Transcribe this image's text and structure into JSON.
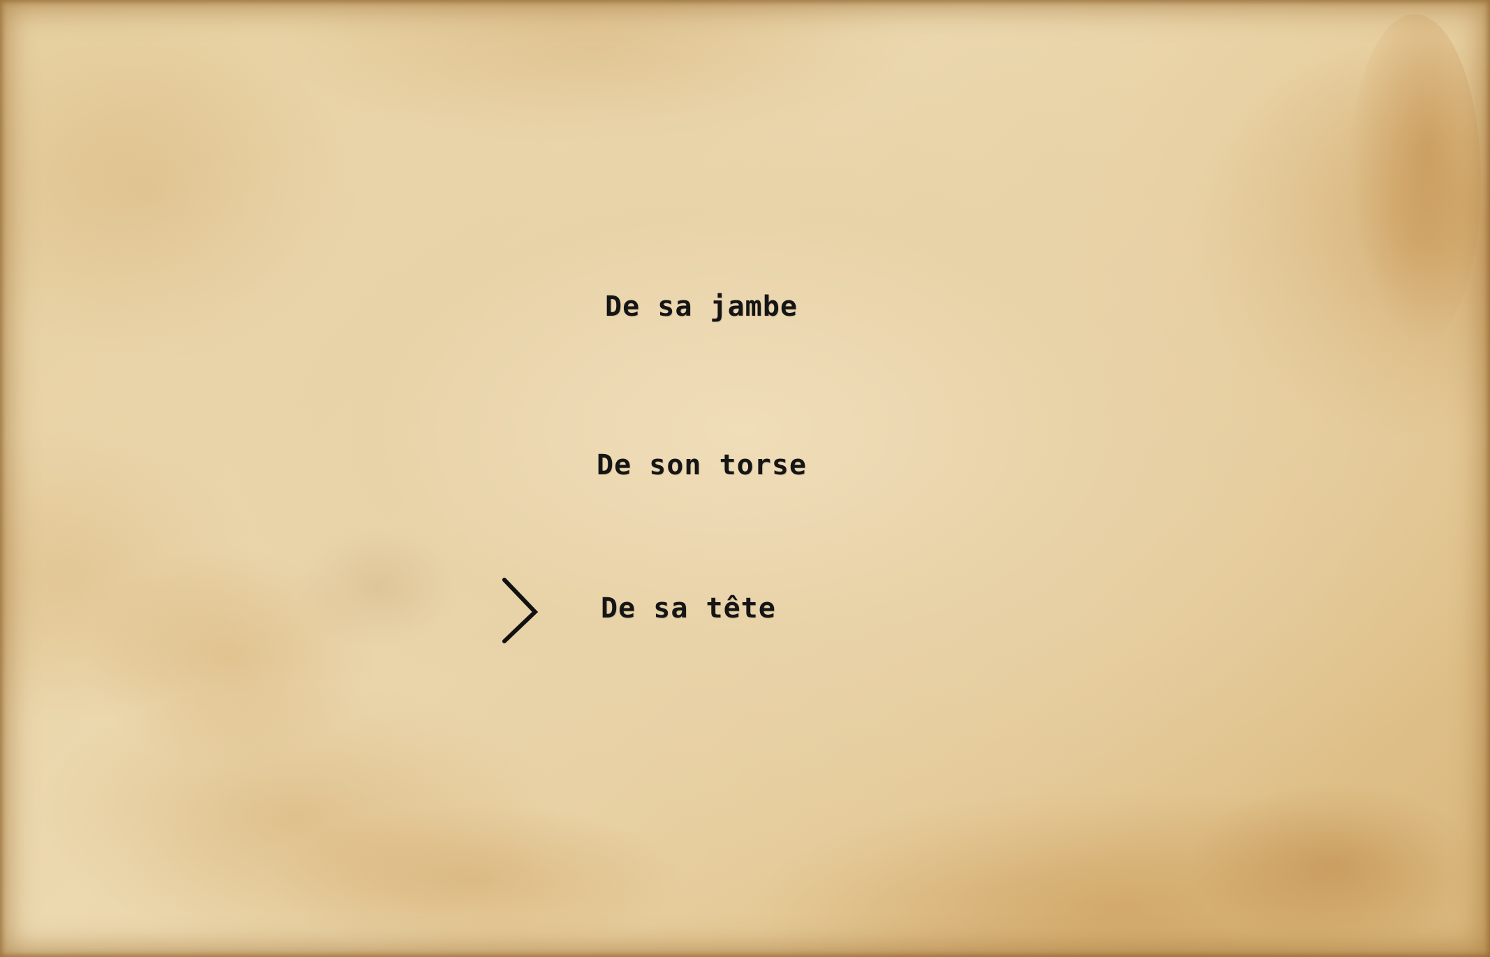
{
  "menu": {
    "options": [
      {
        "label": "De sa jambe",
        "selected": false
      },
      {
        "label": "De son torse",
        "selected": false
      },
      {
        "label": "De sa tête",
        "selected": true
      }
    ],
    "cursor_icon": "chevron-right-icon"
  },
  "colors": {
    "text": "#151515",
    "parchment": "#e6cf9f"
  }
}
